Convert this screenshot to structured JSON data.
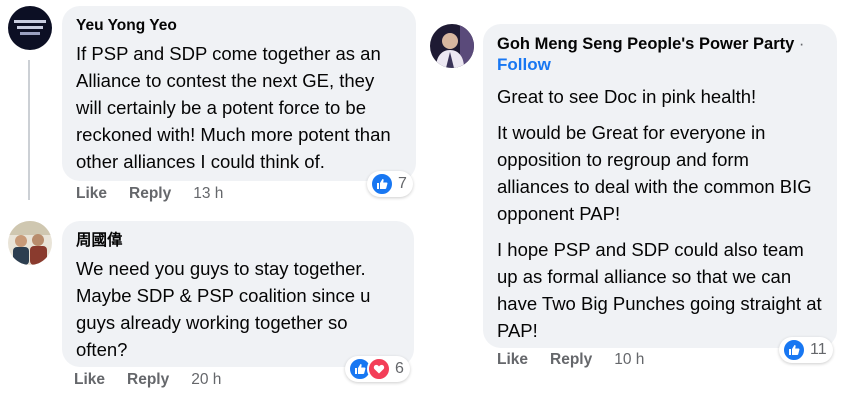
{
  "comments": [
    {
      "author": "Yeu Yong Yeo",
      "paragraphs": [
        "If PSP and SDP come together as an Alliance to contest the next GE, they will certainly be a potent force to be reckoned with! Much more potent than other alliances I could think of."
      ],
      "reaction_count": "7",
      "like_label": "Like",
      "reply_label": "Reply",
      "time": "13 h"
    },
    {
      "author": "周國偉",
      "paragraphs": [
        "We need you guys to stay together. Maybe SDP & PSP coalition since u guys already working together so often?"
      ],
      "reaction_count": "6",
      "like_label": "Like",
      "reply_label": "Reply",
      "time": "20 h"
    },
    {
      "author": "Goh Meng Seng People's Power Party",
      "separator": "·",
      "follow_label": "Follow",
      "paragraphs": [
        "Great to see Doc in pink health!",
        "It would be Great for everyone in opposition to regroup and form alliances to deal with the common BIG opponent PAP!",
        "I hope PSP and SDP could also team up as formal alliance so that we can have Two Big Punches going straight at PAP!"
      ],
      "reaction_count": "11",
      "like_label": "Like",
      "reply_label": "Reply",
      "time": "10 h"
    }
  ],
  "colors": {
    "bubble": "#f0f2f5",
    "like_blue": "#1877f2",
    "love_red": "#f33e58",
    "secondary_text": "#65676b"
  },
  "icons": [
    "like-icon",
    "love-icon"
  ]
}
